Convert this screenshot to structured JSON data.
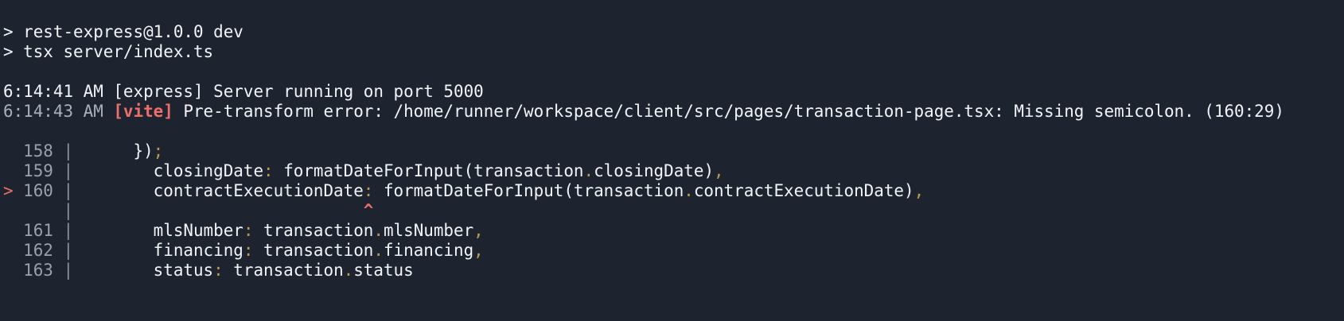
{
  "terminal": {
    "header": [
      "> rest-express@1.0.0 dev",
      "> tsx server/index.ts"
    ],
    "logs": {
      "express": {
        "time": "6:14:41 AM",
        "tag": "[express]",
        "message": "Server running on port 5000"
      },
      "vite": {
        "time": "6:14:43 AM",
        "tag": "[vite]",
        "message": "Pre-transform error: /home/runner/workspace/client/src/pages/transaction-page.tsx: Missing semicolon. (160:29)"
      }
    },
    "code_frame": {
      "error_marker": ">",
      "caret": "^",
      "gutter": "|",
      "lines": [
        {
          "no": "158",
          "indent": "      ",
          "text": "});"
        },
        {
          "no": "159",
          "indent": "        ",
          "key": "closingDate",
          "colon": ":",
          "value": "formatDateForInput(transaction.closingDate)",
          "trail": ","
        },
        {
          "no": "160",
          "indent": "        ",
          "key": "contractExecutionDate",
          "colon": ":",
          "value": "formatDateForInput(transaction.contractExecutionDate)",
          "trail": ","
        },
        {
          "no": "161",
          "indent": "        ",
          "key": "mlsNumber",
          "colon": ":",
          "value": "transaction.mlsNumber",
          "trail": ","
        },
        {
          "no": "162",
          "indent": "        ",
          "key": "financing",
          "colon": ":",
          "value": "transaction.financing",
          "trail": ","
        },
        {
          "no": "163",
          "indent": "        ",
          "key": "status",
          "colon": ":",
          "value": "transaction.status",
          "trail": ""
        }
      ]
    }
  }
}
